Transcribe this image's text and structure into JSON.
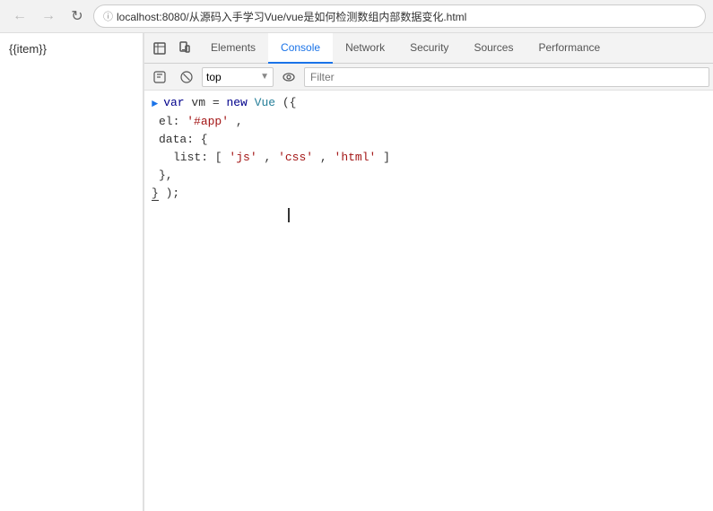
{
  "browser": {
    "url": "localhost:8080/从源码入手学习Vue/vue是如何检测数组内部数据变化.html",
    "back_label": "←",
    "forward_label": "→",
    "refresh_label": "↺"
  },
  "page": {
    "content": "{{item}}"
  },
  "devtools": {
    "tabs": [
      {
        "id": "elements",
        "label": "Elements",
        "active": false
      },
      {
        "id": "console",
        "label": "Console",
        "active": true
      },
      {
        "id": "network",
        "label": "Network",
        "active": false
      },
      {
        "id": "security",
        "label": "Security",
        "active": false
      },
      {
        "id": "sources",
        "label": "Sources",
        "active": false
      },
      {
        "id": "performance",
        "label": "Performance",
        "active": false
      }
    ],
    "toolbar": {
      "context": "top",
      "filter_placeholder": "Filter"
    },
    "console_code": {
      "line1": "var vm = new Vue({",
      "line2_kw": "el:",
      "line2_val": "'#app',",
      "line3": "data: {",
      "line4_kw": "list:",
      "line4_val": "['js','css','html']",
      "line5": "},",
      "line6": "});"
    },
    "icons": {
      "inspect": "⊡",
      "device": "📱",
      "eye": "👁",
      "clear": "🚫",
      "execute": "▶"
    }
  }
}
